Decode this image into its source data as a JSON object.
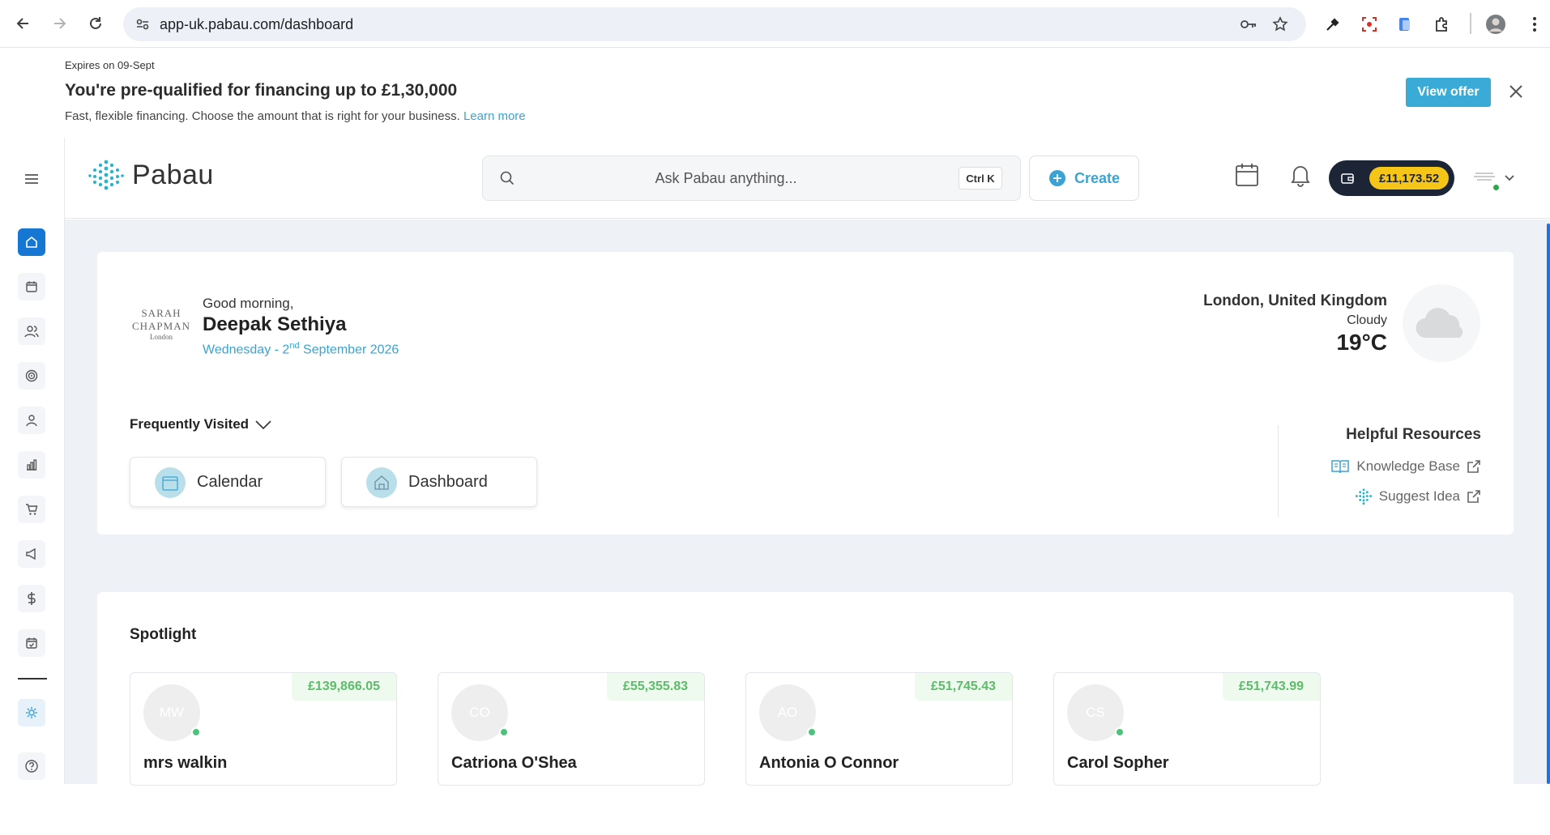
{
  "browser": {
    "url": "app-uk.pabau.com/dashboard"
  },
  "promo": {
    "expires": "Expires on 09-Sept",
    "title": "You're pre-qualified for financing up to £1,30,000",
    "subtitle": "Fast, flexible financing. Choose the amount that is right for your business.",
    "learn_more": "Learn more",
    "cta": "View offer"
  },
  "topbar": {
    "logo": "Pabau",
    "search_placeholder": "Ask Pabau anything...",
    "shortcut": "Ctrl K",
    "create_label": "Create",
    "wallet_amount": "£11,173.52"
  },
  "sidebar": {
    "items": [
      {
        "icon": "home-icon",
        "active": true
      },
      {
        "icon": "calendar-icon"
      },
      {
        "icon": "clients-icon"
      },
      {
        "icon": "target-icon"
      },
      {
        "icon": "user-icon"
      },
      {
        "icon": "reports-icon"
      },
      {
        "icon": "cart-icon"
      },
      {
        "icon": "megaphone-icon"
      },
      {
        "icon": "dollar-icon"
      },
      {
        "icon": "calendar-check-icon"
      },
      {
        "icon": "settings-icon"
      },
      {
        "icon": "help-icon"
      }
    ]
  },
  "greeting": {
    "brand_line1": "SARAH",
    "brand_line2": "CHAPMAN",
    "brand_line3": "London",
    "salutation": "Good morning,",
    "name": "Deepak Sethiya",
    "date_prefix": "Wednesday - 2",
    "date_suffix_sup": "nd",
    "date_rest": " September 2026"
  },
  "weather": {
    "location": "London, United Kingdom",
    "condition": "Cloudy",
    "temperature": "19°C"
  },
  "frequently_visited": {
    "title": "Frequently Visited",
    "items": [
      "Calendar",
      "Dashboard"
    ]
  },
  "helpful_resources": {
    "title": "Helpful Resources",
    "links": [
      "Knowledge Base",
      "Suggest Idea"
    ]
  },
  "spotlight": {
    "title": "Spotlight",
    "people": [
      {
        "initials": "MW",
        "name": "mrs walkin",
        "amount": "£139,866.05"
      },
      {
        "initials": "CO",
        "name": "Catriona O'Shea",
        "amount": "£55,355.83"
      },
      {
        "initials": "AO",
        "name": "Antonia O Connor",
        "amount": "£51,745.43"
      },
      {
        "initials": "CS",
        "name": "Carol Sopher",
        "amount": "£51,743.99"
      }
    ]
  },
  "colors": {
    "accent": "#3aa3d4",
    "active_nav": "#1677d2",
    "wallet_bg": "#1c2536",
    "wallet_amount_bg": "#f5c518",
    "amount_green": "#5cbc6a"
  }
}
